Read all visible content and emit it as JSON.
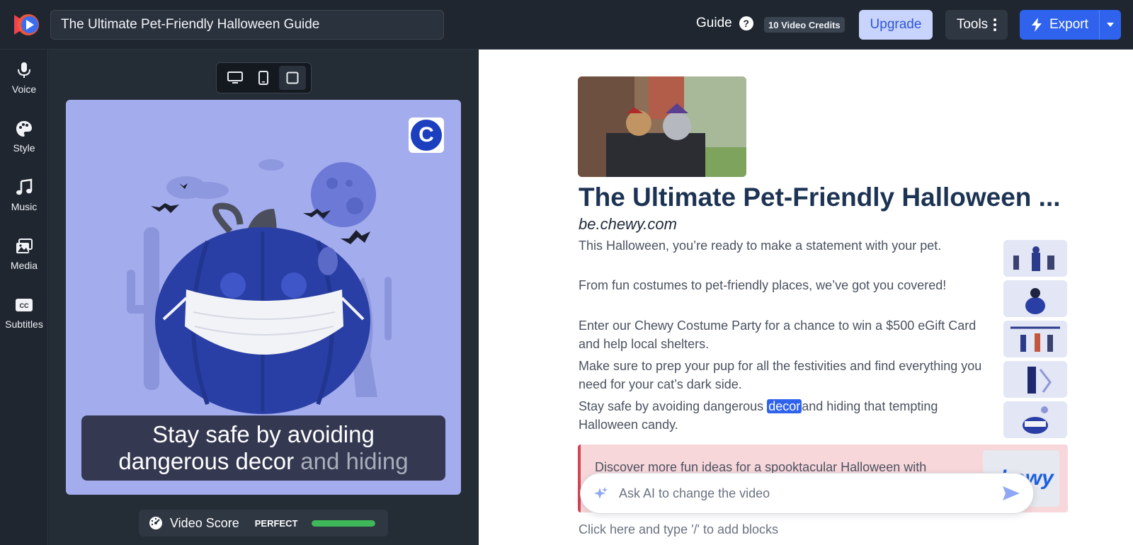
{
  "header": {
    "project_title": "The Ultimate Pet-Friendly Halloween Guide",
    "guide_label": "Guide",
    "guide_help": "?",
    "credits_label": "10 Video Credits",
    "upgrade_label": "Upgrade",
    "tools_label": "Tools",
    "export_label": "Export"
  },
  "sidebar": {
    "items": [
      {
        "label": "Voice",
        "icon": "microphone-icon"
      },
      {
        "label": "Style",
        "icon": "palette-icon"
      },
      {
        "label": "Music",
        "icon": "music-note-icon"
      },
      {
        "label": "Media",
        "icon": "media-icon"
      },
      {
        "label": "Subtitles",
        "icon": "closed-captions-icon"
      }
    ]
  },
  "preview": {
    "view_modes": [
      {
        "name": "desktop",
        "icon": "desktop-icon"
      },
      {
        "name": "mobile",
        "icon": "mobile-icon"
      },
      {
        "name": "square",
        "icon": "square-icon"
      }
    ],
    "active_view": "square",
    "brand_badge_letter": "C",
    "caption_spoken": "Stay safe by avoiding dangerous decor",
    "caption_upcoming": "and hiding",
    "score_label": "Video Score",
    "score_status": "PERFECT",
    "score_fraction": 1.0,
    "colors": {
      "canvas_bg": "#a3acec",
      "pumpkin": "#2a3fa5",
      "accent": "#2f63ee",
      "score_fill": "#3fb859"
    }
  },
  "document": {
    "title": "The Ultimate Pet-Friendly Halloween ...",
    "source": "be.chewy.com",
    "paragraphs": [
      {
        "text": "This Halloween, you’re ready to make a statement with your pet."
      },
      {
        "text": "From fun costumes to pet-friendly places, we’ve got you covered!"
      },
      {
        "text": "Enter our Chewy Costume Party for a chance to win a $500 eGift Card and help local shelters."
      },
      {
        "text": "Make sure to prep your pup for all the festivities and find everything you need for your cat’s dark side."
      },
      {
        "before": "Stay safe by avoiding dangerous ",
        "highlight": "decor",
        "after": "and hiding that tempting Halloween candy."
      }
    ],
    "callout_text": "Discover more fun ideas for a spooktacular Halloween with",
    "callout_logo": "chewy",
    "ask_ai_placeholder": "Ask AI to change the video",
    "add_blocks_hint": "Click here and type '/' to add blocks"
  }
}
